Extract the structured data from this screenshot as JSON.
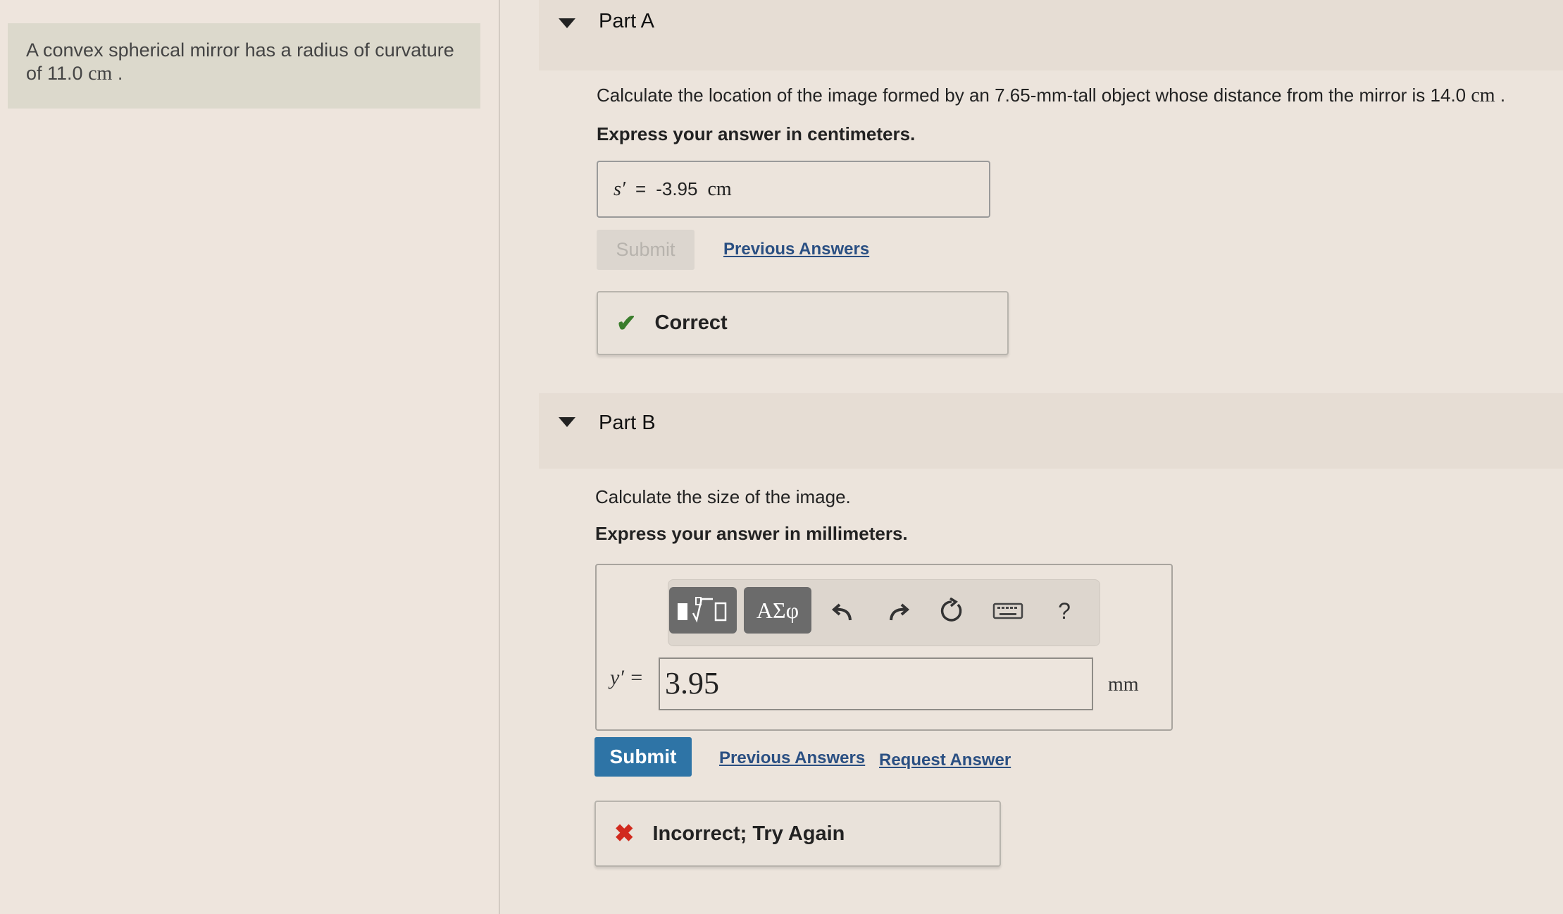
{
  "problem": {
    "text_before": "A convex spherical mirror has a radius of curvature of 11.0",
    "unit": "cm",
    "text_after": "."
  },
  "partA": {
    "title": "Part A",
    "question_text": "Calculate the location of the image formed by an 7.65-mm-tall object whose distance from the mirror is 14.0",
    "question_unit": "cm",
    "question_end": ".",
    "instruction": "Express your answer in centimeters.",
    "answer": {
      "var": "s′",
      "eq": "=",
      "value": "-3.95",
      "unit": "cm"
    },
    "submit_label": "Submit",
    "previous_answers": "Previous Answers",
    "feedback_mark": "✔",
    "feedback": "Correct"
  },
  "partB": {
    "title": "Part B",
    "question": "Calculate the size of the image.",
    "instruction": "Express your answer in millimeters.",
    "toolbar": {
      "templates_icon": "sqrt-template-icon",
      "greek_label": "ΑΣφ",
      "undo_icon": "undo-icon",
      "redo_icon": "redo-icon",
      "reset_icon": "reset-icon",
      "keyboard_icon": "keyboard-icon",
      "help_label": "?"
    },
    "input_label": "y′ =",
    "input_value": "3.95",
    "unit": "mm",
    "submit_label": "Submit",
    "previous_answers": "Previous Answers",
    "request_answer": "Request Answer",
    "feedback_mark": "✖",
    "feedback": "Incorrect; Try Again"
  },
  "colors": {
    "correct": "#3a7d2c",
    "incorrect": "#d12a1e",
    "primary_button": "#2e74a6",
    "link": "#2a4f82"
  }
}
